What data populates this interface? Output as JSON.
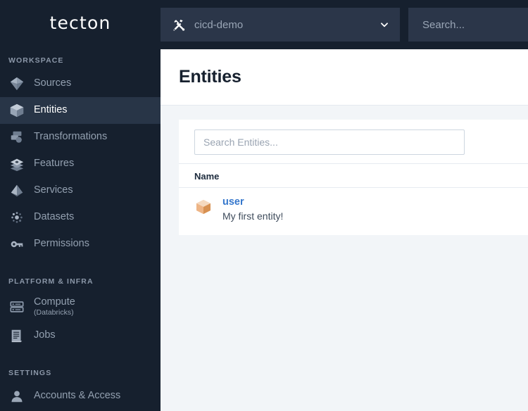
{
  "brand": {
    "logo_text": "tecton"
  },
  "sidebar": {
    "sections": [
      {
        "label": "WORKSPACE",
        "items": [
          {
            "label": "Sources",
            "icon": "gem-icon",
            "active": false
          },
          {
            "label": "Entities",
            "icon": "cube-icon",
            "active": true
          },
          {
            "label": "Transformations",
            "icon": "transformations-icon",
            "active": false
          },
          {
            "label": "Features",
            "icon": "layers-icon",
            "active": false
          },
          {
            "label": "Services",
            "icon": "pyramid-icon",
            "active": false
          },
          {
            "label": "Datasets",
            "icon": "dots-scatter-icon",
            "active": false
          },
          {
            "label": "Permissions",
            "icon": "key-icon",
            "active": false
          }
        ]
      },
      {
        "label": "PLATFORM & INFRA",
        "items": [
          {
            "label": "Compute",
            "sub": "(Databricks)",
            "icon": "server-icon",
            "active": false
          },
          {
            "label": "Jobs",
            "icon": "document-list-icon",
            "active": false
          }
        ]
      },
      {
        "label": "SETTINGS",
        "items": [
          {
            "label": "Accounts & Access",
            "icon": "person-icon",
            "active": false
          }
        ]
      }
    ]
  },
  "topbar": {
    "workspace_selector": {
      "icon": "hammer-wrench-icon",
      "value": "cicd-demo",
      "chevron": "chevron-down-icon"
    },
    "search": {
      "placeholder": "Search..."
    }
  },
  "main": {
    "title": "Entities",
    "entity_search": {
      "placeholder": "Search Entities..."
    },
    "table": {
      "columns": [
        "Name"
      ],
      "rows": [
        {
          "icon": "entity-cube-icon",
          "name": "user",
          "description": "My first entity!"
        }
      ]
    }
  },
  "colors": {
    "sidebar_bg": "#16202e",
    "sidebar_active_bg": "#283547",
    "topbar_field_bg": "#2b3649",
    "page_bg": "#f2f5f8",
    "card_bg": "#ffffff",
    "link_blue": "#3577cc",
    "entity_orange": "#e0a070"
  }
}
